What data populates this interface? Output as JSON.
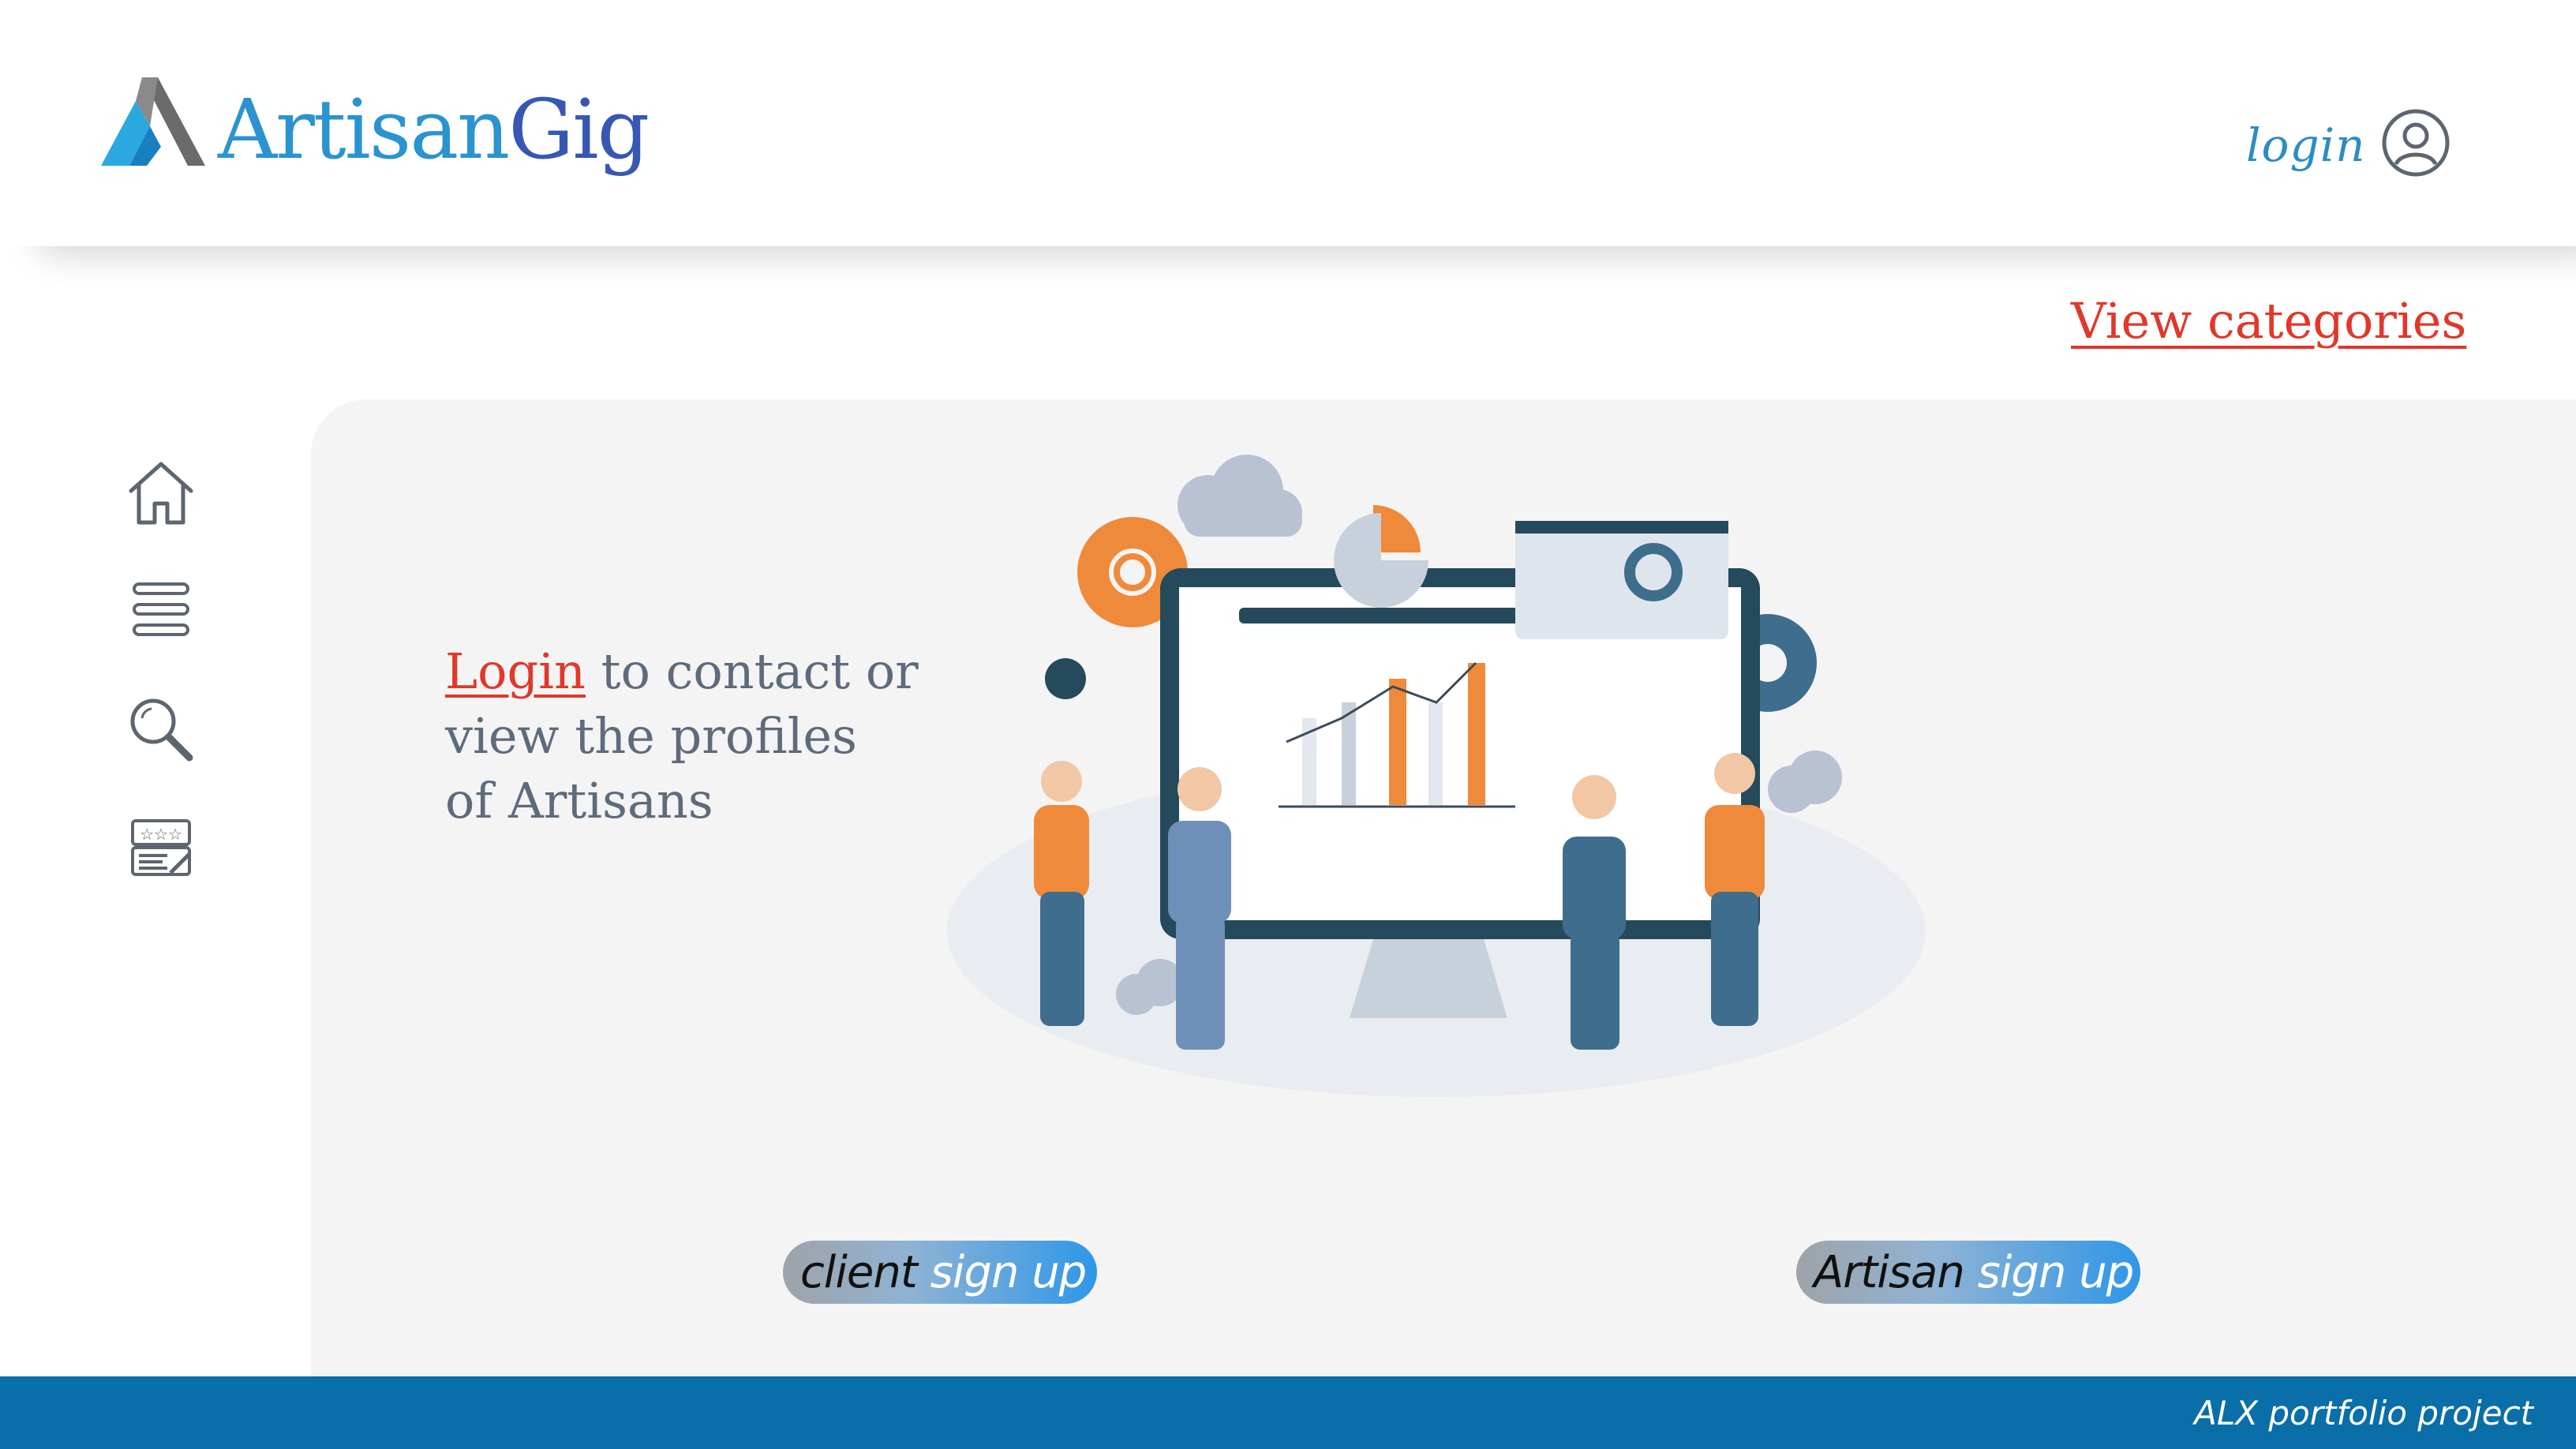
{
  "header": {
    "brand_part1": "Artisan",
    "brand_part2": "Gig",
    "login_label": "login"
  },
  "nav": {
    "view_categories": "View categories",
    "sidebar_icons": [
      "home-icon",
      "menu-icon",
      "search-icon",
      "reviews-icon"
    ]
  },
  "main": {
    "login_link": "Login",
    "message_rest": " to contact or view the profiles of Artisans",
    "client_signup_a": "client",
    "client_signup_b": " sign up",
    "artisan_signup_a": "Artisan",
    "artisan_signup_b": " sign up"
  },
  "footer": {
    "text": "ALX portfolio project"
  },
  "colors": {
    "brand_light": "#2b93cf",
    "brand_dark": "#3856b3",
    "accent_red": "#e0382a",
    "footer_bg": "#0a6ea8",
    "card_bg": "#f4f4f5"
  }
}
